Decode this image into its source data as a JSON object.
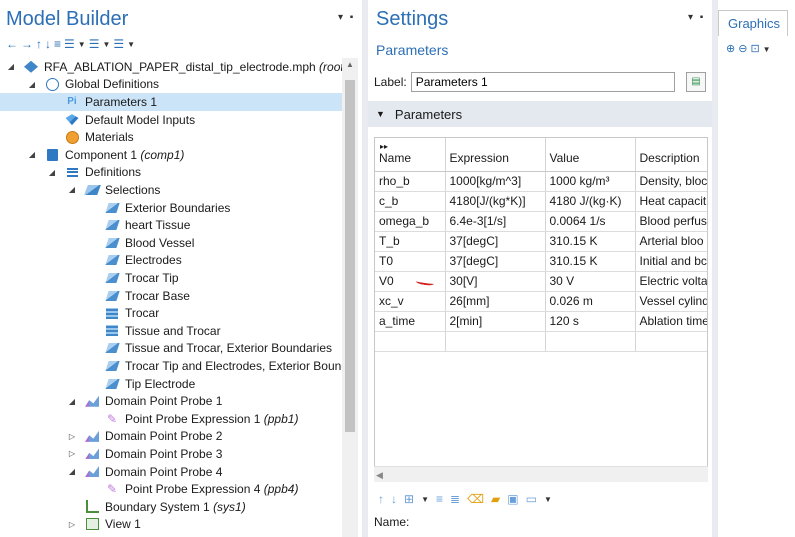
{
  "model_builder": {
    "title": "Model Builder",
    "tree": [
      {
        "label": "RFA_ABLATION_PAPER_distal_tip_electrode.mph",
        "tag": "(root)",
        "icon": "model-file-icon"
      },
      {
        "label": "Global Definitions",
        "tag": "",
        "icon": "globe-icon"
      },
      {
        "label": "Parameters 1",
        "tag": "",
        "icon": "parameters-icon"
      },
      {
        "label": "Default Model Inputs",
        "tag": "",
        "icon": "model-inputs-icon"
      },
      {
        "label": "Materials",
        "tag": "",
        "icon": "materials-icon"
      },
      {
        "label": "Component 1",
        "tag": "(comp1)",
        "icon": "component-icon"
      },
      {
        "label": "Definitions",
        "tag": "",
        "icon": "definitions-icon"
      },
      {
        "label": "Selections",
        "tag": "",
        "icon": "selections-icon"
      },
      {
        "label": "Exterior Boundaries",
        "tag": "",
        "icon": "selection-icon"
      },
      {
        "label": "heart Tissue",
        "tag": "",
        "icon": "selection-icon"
      },
      {
        "label": "Blood Vessel",
        "tag": "",
        "icon": "selection-icon"
      },
      {
        "label": "Electrodes",
        "tag": "",
        "icon": "selection-icon"
      },
      {
        "label": "Trocar Tip",
        "tag": "",
        "icon": "selection-icon"
      },
      {
        "label": "Trocar Base",
        "tag": "",
        "icon": "selection-icon"
      },
      {
        "label": "Trocar",
        "tag": "",
        "icon": "boolean-selection-icon"
      },
      {
        "label": "Tissue and Trocar",
        "tag": "",
        "icon": "boolean-selection-icon"
      },
      {
        "label": "Tissue and Trocar, Exterior Boundaries",
        "tag": "",
        "icon": "selection-icon"
      },
      {
        "label": "Trocar Tip and Electrodes, Exterior Bound",
        "tag": "",
        "icon": "selection-icon"
      },
      {
        "label": "Tip Electrode",
        "tag": "",
        "icon": "selection-icon"
      },
      {
        "label": "Domain Point Probe 1",
        "tag": "",
        "icon": "probe-icon"
      },
      {
        "label": "Point Probe Expression 1",
        "tag": "(ppb1)",
        "icon": "probe-expression-icon"
      },
      {
        "label": "Domain Point Probe 2",
        "tag": "",
        "icon": "probe-icon"
      },
      {
        "label": "Domain Point Probe 3",
        "tag": "",
        "icon": "probe-icon"
      },
      {
        "label": "Domain Point Probe 4",
        "tag": "",
        "icon": "probe-icon"
      },
      {
        "label": "Point Probe Expression 4",
        "tag": "(ppb4)",
        "icon": "probe-expression-icon"
      },
      {
        "label": "Boundary System 1",
        "tag": "(sys1)",
        "icon": "boundary-system-icon"
      },
      {
        "label": "View 1",
        "tag": "",
        "icon": "view-icon"
      }
    ]
  },
  "settings": {
    "title": "Settings",
    "subtitle": "Parameters",
    "label_caption": "Label:",
    "label_value": "Parameters 1",
    "section_title": "Parameters",
    "columns": [
      "Name",
      "Expression",
      "Value",
      "Description"
    ],
    "rows": [
      [
        "rho_b",
        "1000[kg/m^3]",
        "1000 kg/m³",
        "Density, bloc"
      ],
      [
        "c_b",
        "4180[J/(kg*K)]",
        "4180 J/(kg·K)",
        "Heat capacit"
      ],
      [
        "omega_b",
        "6.4e-3[1/s]",
        "0.0064 1/s",
        "Blood perfus"
      ],
      [
        "T_b",
        "37[degC]",
        "310.15 K",
        "Arterial bloo"
      ],
      [
        "T0",
        "37[degC]",
        "310.15 K",
        "Initial and bc"
      ],
      [
        "V0",
        "30[V]",
        "30 V",
        "Electric volta"
      ],
      [
        "xc_v",
        "26[mm]",
        "0.026 m",
        "Vessel cylinde"
      ],
      [
        "a_time",
        "2[min]",
        "120 s",
        "Ablation time"
      ],
      [
        "",
        "",
        "",
        ""
      ]
    ],
    "name_caption": "Name:"
  },
  "graphics": {
    "tab_label": "Graphics"
  }
}
